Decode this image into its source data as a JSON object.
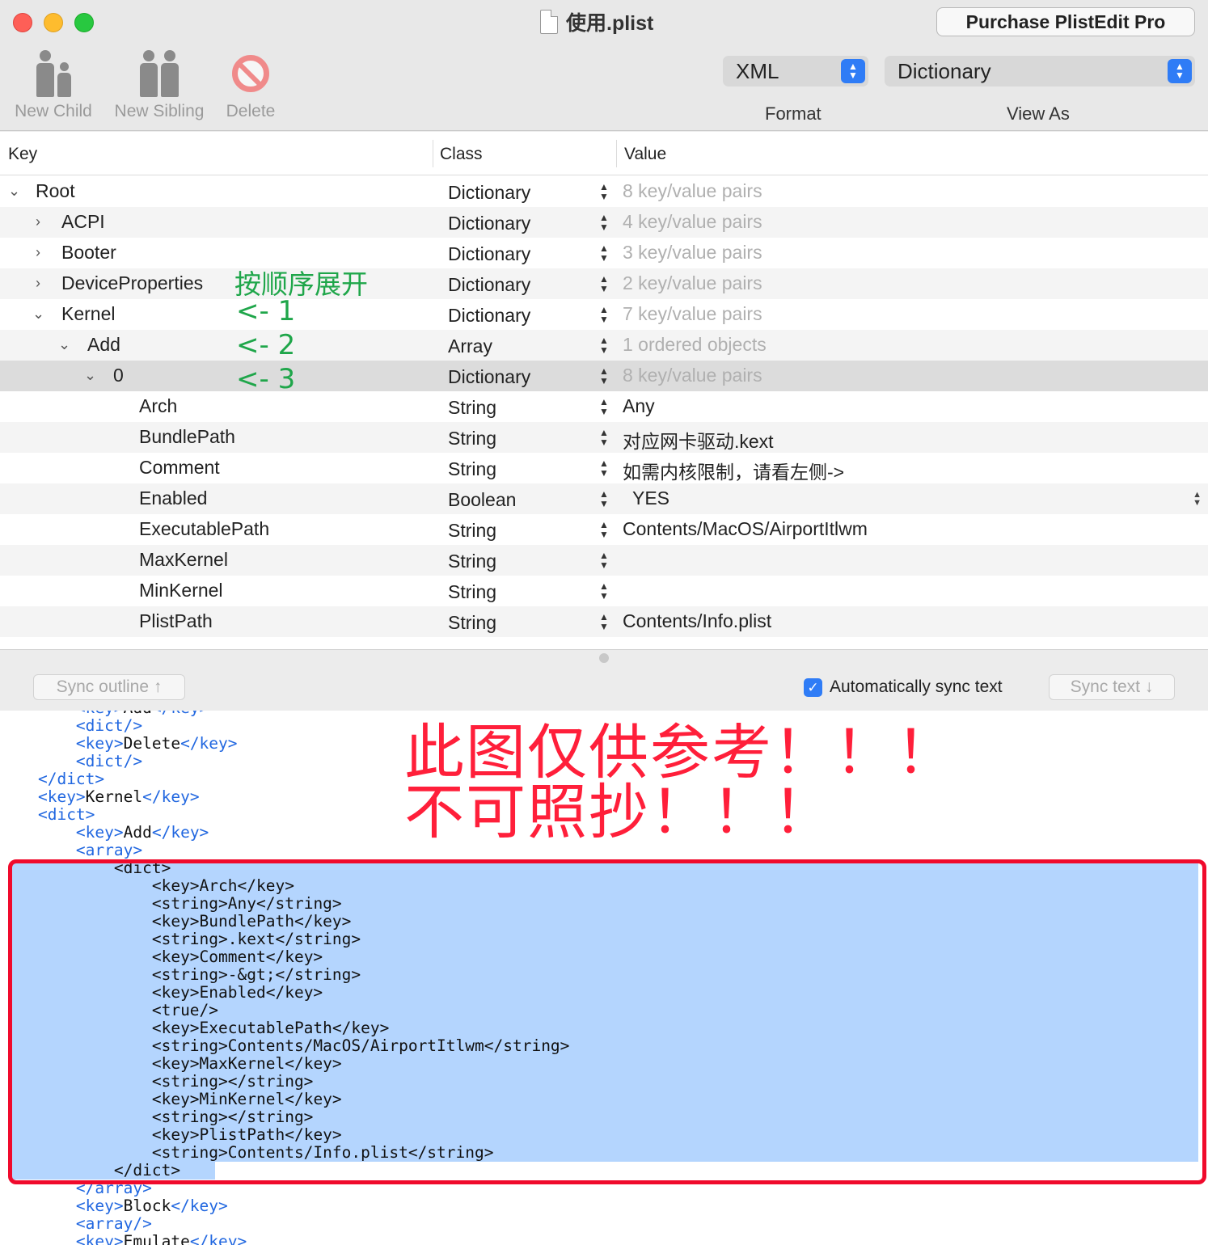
{
  "window": {
    "title": "使用.plist",
    "purchase_label": "Purchase PlistEdit Pro"
  },
  "toolbar": {
    "new_child": "New Child",
    "new_sibling": "New Sibling",
    "delete": "Delete",
    "format_value": "XML",
    "format_label": "Format",
    "view_as_value": "Dictionary",
    "view_as_label": "View As"
  },
  "columns": {
    "key": "Key",
    "class": "Class",
    "value": "Value"
  },
  "rows": [
    {
      "key": "Root",
      "class": "Dictionary",
      "value": "8 key/value pairs"
    },
    {
      "key": "ACPI",
      "class": "Dictionary",
      "value": "4 key/value pairs"
    },
    {
      "key": "Booter",
      "class": "Dictionary",
      "value": "3 key/value pairs"
    },
    {
      "key": "DeviceProperties",
      "class": "Dictionary",
      "value": "2 key/value pairs"
    },
    {
      "key": "Kernel",
      "class": "Dictionary",
      "value": "7 key/value pairs"
    },
    {
      "key": "Add",
      "class": "Array",
      "value": "1 ordered objects"
    },
    {
      "key": "0",
      "class": "Dictionary",
      "value": "8 key/value pairs"
    },
    {
      "key": "Arch",
      "class": "String",
      "value": "Any"
    },
    {
      "key": "BundlePath",
      "class": "String",
      "value": "对应网卡驱动.kext"
    },
    {
      "key": "Comment",
      "class": "String",
      "value": "如需内核限制，请看左侧->"
    },
    {
      "key": "Enabled",
      "class": "Boolean",
      "value": "YES"
    },
    {
      "key": "ExecutablePath",
      "class": "String",
      "value": "Contents/MacOS/AirportItlwm"
    },
    {
      "key": "MaxKernel",
      "class": "String",
      "value": ""
    },
    {
      "key": "MinKernel",
      "class": "String",
      "value": ""
    },
    {
      "key": "PlistPath",
      "class": "String",
      "value": "Contents/Info.plist"
    }
  ],
  "annotations": {
    "expand_hint": "按顺序展开",
    "step1": "<- 1",
    "step2": "<- 2",
    "step3": "<- 3"
  },
  "sync": {
    "sync_outline": "Sync outline ↑",
    "auto_sync": "Automatically sync text",
    "sync_text": "Sync text ↓"
  },
  "warning": {
    "line1": "此图仅供参考！！！",
    "line2": "不可照抄！！！"
  },
  "code_lines": [
    "        <key>Add</key>",
    "        <dict/>",
    "        <key>Delete</key>",
    "        <dict/>",
    "    </dict>",
    "    <key>Kernel</key>",
    "    <dict>",
    "        <key>Add</key>",
    "        <array>",
    "            <dict>",
    "                <key>Arch</key>",
    "                <string>Any</string>",
    "                <key>BundlePath</key>",
    "                <string>.kext</string>",
    "                <key>Comment</key>",
    "                <string>-&gt;</string>",
    "                <key>Enabled</key>",
    "                <true/>",
    "                <key>ExecutablePath</key>",
    "                <string>Contents/MacOS/AirportItlwm</string>",
    "                <key>MaxKernel</key>",
    "                <string></string>",
    "                <key>MinKernel</key>",
    "                <string></string>",
    "                <key>PlistPath</key>",
    "                <string>Contents/Info.plist</string>",
    "            </dict>",
    "        </array>",
    "        <key>Block</key>",
    "        <array/>",
    "        <key>Emulate</key>"
  ]
}
